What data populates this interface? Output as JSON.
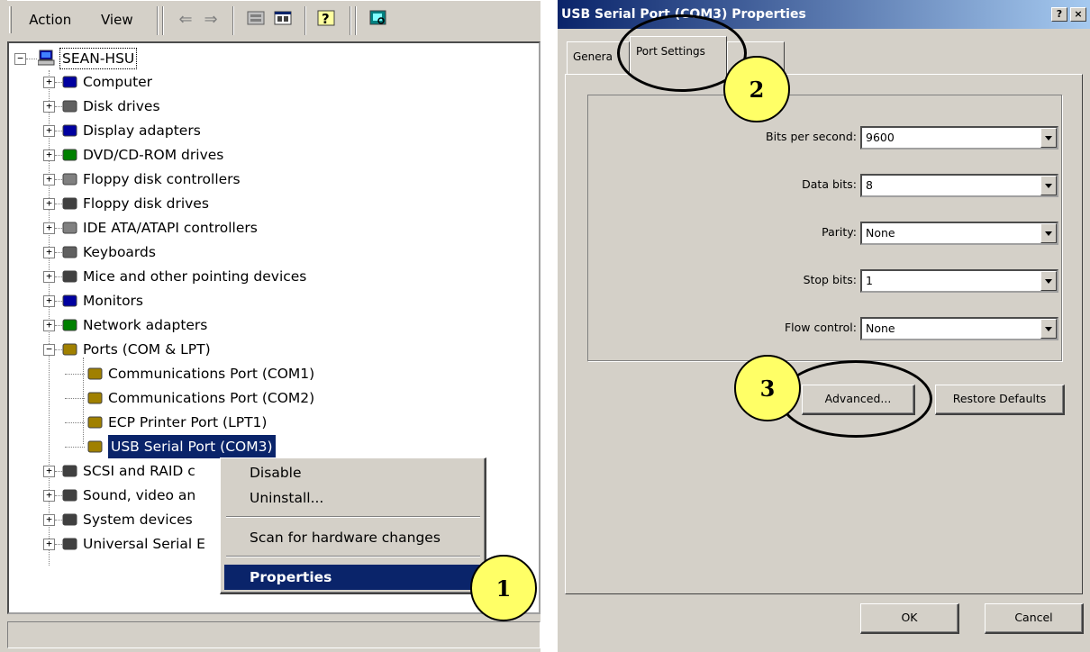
{
  "device_manager": {
    "menu": {
      "action": "Action",
      "view": "View"
    },
    "toolbar_icons": [
      "back-arrow-icon",
      "forward-arrow-icon",
      "device-list-icon",
      "properties-view-icon",
      "help-icon",
      "scan-hardware-icon"
    ],
    "tree": {
      "root": "SEAN-HSU",
      "categories": [
        "Computer",
        "Disk drives",
        "Display adapters",
        "DVD/CD-ROM drives",
        "Floppy disk controllers",
        "Floppy disk drives",
        "IDE ATA/ATAPI controllers",
        "Keyboards",
        "Mice and other pointing devices",
        "Monitors",
        "Network adapters",
        "Ports (COM & LPT)"
      ],
      "ports_children": [
        "Communications Port (COM1)",
        "Communications Port (COM2)",
        "ECP Printer Port (LPT1)",
        "USB Serial Port (COM3)"
      ],
      "after_ports": [
        "SCSI and RAID c",
        "Sound, video an",
        "System devices",
        "Universal Serial E"
      ]
    },
    "context_menu": {
      "disable": "Disable",
      "uninstall": "Uninstall...",
      "scan": "Scan for hardware changes",
      "properties": "Properties"
    }
  },
  "dialog": {
    "title": "USB Serial Port (COM3) Properties",
    "title_buttons": {
      "help": "?",
      "close": "×"
    },
    "tabs": {
      "general": "Genera",
      "port_settings": "Port Settings"
    },
    "fields": [
      {
        "label": "Bits per second:",
        "value": "9600"
      },
      {
        "label": "Data bits:",
        "value": "8"
      },
      {
        "label": "Parity:",
        "value": "None"
      },
      {
        "label": "Stop bits:",
        "value": "1"
      },
      {
        "label": "Flow control:",
        "value": "None"
      }
    ],
    "buttons": {
      "advanced": "Advanced...",
      "restore": "Restore Defaults",
      "ok": "OK",
      "cancel": "Cancel"
    }
  },
  "callouts": {
    "one": "1",
    "two": "2",
    "three": "3"
  },
  "colors": {
    "selection": "#0a246a",
    "callout": "#ffff66",
    "face": "#d4d0c8"
  }
}
